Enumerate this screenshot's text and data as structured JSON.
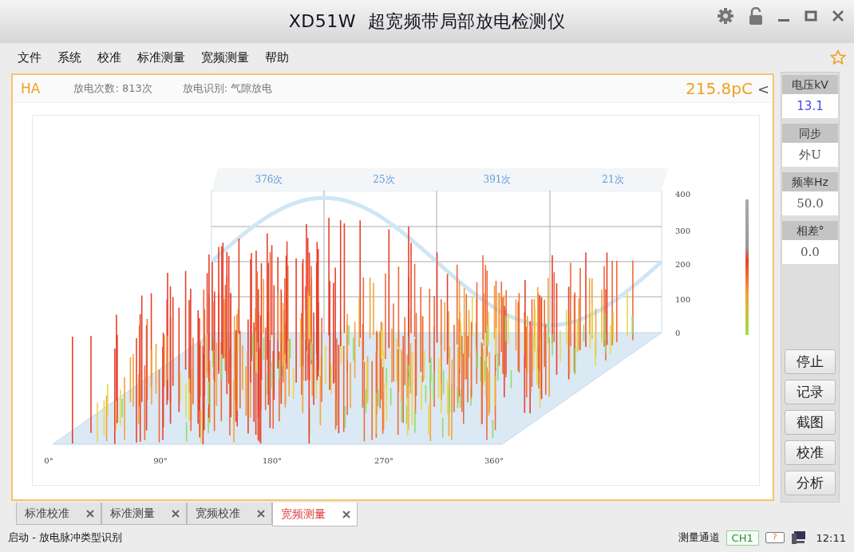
{
  "window": {
    "title": "XD51W  超宽频带局部放电检测仪"
  },
  "menu": [
    "文件",
    "系统",
    "校准",
    "标准测量",
    "宽频测量",
    "帮助"
  ],
  "panel": {
    "channel": "HA",
    "count": "放电次数: 813次",
    "recognition": "放电识别: 气隙放电",
    "amplitude": "215.8pC",
    "collapse": "<"
  },
  "prpd": {
    "quadrant_counts": [
      "376次",
      "25次",
      "391次",
      "21次"
    ],
    "y_ticks": [
      "400",
      "300",
      "200",
      "100",
      "0"
    ],
    "x_ticks": [
      "0°",
      "90°",
      "180°",
      "270°",
      "360°"
    ]
  },
  "side_panel": {
    "readings": [
      {
        "label": "电压kV",
        "value": "13.1"
      },
      {
        "label": "同步",
        "value": "外U"
      },
      {
        "label": "频率Hz",
        "value": "50.0"
      },
      {
        "label": "相差°",
        "value": "0.0"
      }
    ],
    "buttons": [
      "停止",
      "记录",
      "截图",
      "校准",
      "分析"
    ]
  },
  "tabs": [
    {
      "label": "标准校准",
      "selected": false
    },
    {
      "label": "标准测量",
      "selected": false
    },
    {
      "label": "宽频校准",
      "selected": false
    },
    {
      "label": "宽频测量",
      "selected": true
    }
  ],
  "status_bar": {
    "message": "启动 - 放电脉冲类型识别",
    "channel_label": "测量通道",
    "channel": "CH1",
    "battery": "?",
    "time": "12:11"
  }
}
